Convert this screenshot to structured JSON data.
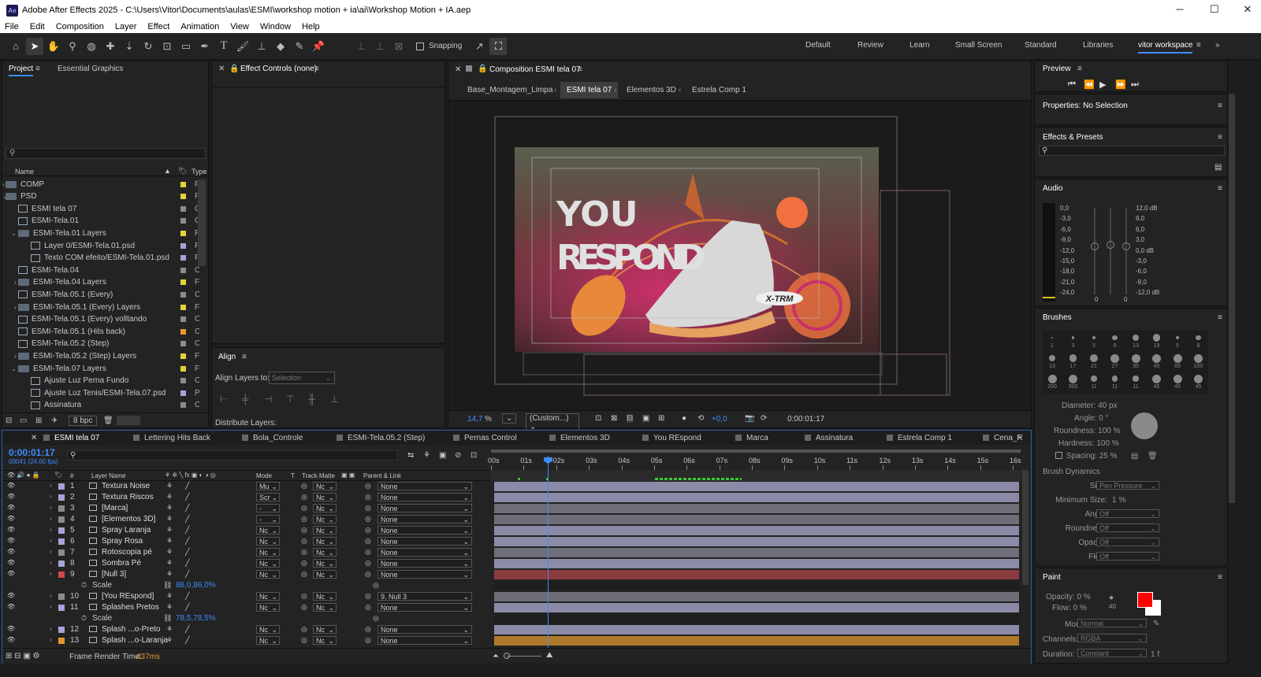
{
  "titlebar": {
    "app_icon": "Ae",
    "title": "Adobe After Effects 2025 - C:\\Users\\Vitor\\Documents\\aulas\\ESMI\\workshop motion + ia\\ai\\Workshop Motion + IA.aep"
  },
  "menu": [
    "File",
    "Edit",
    "Composition",
    "Layer",
    "Effect",
    "Animation",
    "View",
    "Window",
    "Help"
  ],
  "toolbar": {
    "snapping": "Snapping"
  },
  "workspaces": [
    "Default",
    "Review",
    "Learn",
    "Small Screen",
    "Standard",
    "Libraries",
    "vitor workspace"
  ],
  "project": {
    "tab_project": "Project",
    "tab_essential": "Essential Graphics",
    "col_name": "Name",
    "col_type": "Type",
    "items": [
      {
        "name": "COMP",
        "type": "Fo",
        "color": "#e3d23c",
        "indent": 0,
        "kind": "folder",
        "twirl": "right"
      },
      {
        "name": "PSD",
        "type": "Fo",
        "color": "#e3d23c",
        "indent": 0,
        "kind": "folder",
        "twirl": "down"
      },
      {
        "name": "ESMI tela 07",
        "type": "C",
        "color": "#8c8c8c",
        "indent": 1,
        "kind": "comp",
        "twirl": ""
      },
      {
        "name": "ESMI-Tela.01",
        "type": "C",
        "color": "#8c8c8c",
        "indent": 1,
        "kind": "comp",
        "twirl": ""
      },
      {
        "name": "ESMI-Tela.01 Layers",
        "type": "Fo",
        "color": "#e3d23c",
        "indent": 1,
        "kind": "folder",
        "twirl": "down"
      },
      {
        "name": "Layer 0/ESMI-Tela.01.psd",
        "type": "Pl",
        "color": "#a4a4d8",
        "indent": 2,
        "kind": "comp",
        "twirl": ""
      },
      {
        "name": "Texto COM efeito/ESMI-Tela.01.psd",
        "type": "Pl",
        "color": "#a4a4d8",
        "indent": 2,
        "kind": "comp",
        "twirl": ""
      },
      {
        "name": "ESMI-Tela.04",
        "type": "C",
        "color": "#8c8c8c",
        "indent": 1,
        "kind": "comp",
        "twirl": ""
      },
      {
        "name": "ESMI-Tela.04 Layers",
        "type": "Fo",
        "color": "#e3d23c",
        "indent": 1,
        "kind": "folder",
        "twirl": "right"
      },
      {
        "name": "ESMI-Tela.05.1 (Every)",
        "type": "C",
        "color": "#8c8c8c",
        "indent": 1,
        "kind": "comp",
        "twirl": ""
      },
      {
        "name": "ESMI-Tela.05.1 (Every) Layers",
        "type": "Fo",
        "color": "#e3d23c",
        "indent": 1,
        "kind": "folder",
        "twirl": "right"
      },
      {
        "name": "ESMI-Tela.05.1 (Every) volltando",
        "type": "C",
        "color": "#8c8c8c",
        "indent": 1,
        "kind": "comp",
        "twirl": ""
      },
      {
        "name": "ESMI-Tela.05.1 (Hits back)",
        "type": "C",
        "color": "#e39a2c",
        "indent": 1,
        "kind": "comp",
        "twirl": ""
      },
      {
        "name": "ESMI-Tela.05.2 (Step)",
        "type": "C",
        "color": "#8c8c8c",
        "indent": 1,
        "kind": "comp",
        "twirl": ""
      },
      {
        "name": "ESMI-Tela.05.2 (Step) Layers",
        "type": "Fo",
        "color": "#e3d23c",
        "indent": 1,
        "kind": "folder",
        "twirl": "right"
      },
      {
        "name": "ESMI-Tela.07 Layers",
        "type": "Fo",
        "color": "#e3d23c",
        "indent": 1,
        "kind": "folder",
        "twirl": "down"
      },
      {
        "name": "Ajuste Luz Perna Fundo",
        "type": "C",
        "color": "#8c8c8c",
        "indent": 2,
        "kind": "comp",
        "twirl": ""
      },
      {
        "name": "Ajuste Luz Tenis/ESMI-Tela.07.psd",
        "type": "Pl",
        "color": "#a4a4d8",
        "indent": 2,
        "kind": "comp",
        "twirl": ""
      },
      {
        "name": "Assinatura",
        "type": "C",
        "color": "#8c8c8c",
        "indent": 2,
        "kind": "comp",
        "twirl": ""
      }
    ],
    "bpc": "8 bpc"
  },
  "effect_controls": {
    "title": "Effect Controls (none)"
  },
  "align": {
    "title": "Align",
    "align_to_label": "Align Layers to:",
    "align_to_value": "Selection",
    "distribute": "Distribute Layers:"
  },
  "composition": {
    "title": "Composition ESMI tela 07",
    "breadcrumbs": [
      "Base_Montagem_Limpa",
      "ESMI tela 07",
      "Elementos 3D",
      "Estrela Comp 1"
    ],
    "artwork_text": "YOU RESPOND",
    "brand": "X-TRM",
    "zoom": "14,7",
    "zoom_unit": "%",
    "resolution": "(Custom...)",
    "exposure": "+0,0",
    "timecode": "0:00:01:17"
  },
  "right": {
    "preview": "Preview",
    "properties": "Properties: No Selection",
    "effects_presets": "Effects & Presets",
    "audio": "Audio",
    "audio_left": [
      "0,0",
      "-3,0",
      "-6,0",
      "-9,0",
      "-12,0",
      "-15,0",
      "-18,0",
      "-21,0",
      "-24,0"
    ],
    "audio_right": [
      "12,0 dB",
      "9,0",
      "6,0",
      "3,0",
      "0,0 dB",
      "-3,0",
      "-6,0",
      "-9,0",
      "-12,0 dB"
    ],
    "audio_zero_left": "0",
    "audio_zero_right": "0",
    "brushes": "Brushes",
    "brush_sizes": [
      "1",
      "3",
      "5",
      "9",
      "13",
      "19",
      "5",
      "9",
      "13",
      "17",
      "21",
      "27",
      "35",
      "45",
      "65",
      "100",
      "200",
      "300",
      "11",
      "11",
      "11",
      "45",
      "45",
      "45"
    ],
    "diameter": "Diameter: 40 px",
    "angle": "Angle: 0 °",
    "roundness": "Roundness: 100 %",
    "hardness": "Hardness: 100 %",
    "spacing": "Spacing: 25 %",
    "brush_dynamics": "Brush Dynamics",
    "dyn": [
      {
        "label": "Size:",
        "value": "Pen Pressure"
      },
      {
        "label": "Minimum Size:",
        "value": "1 %"
      },
      {
        "label": "Angle:",
        "value": "Off"
      },
      {
        "label": "Roundness:",
        "value": "Off"
      },
      {
        "label": "Opacity:",
        "value": "Off"
      },
      {
        "label": "Flow:",
        "value": "Off"
      }
    ],
    "paint": "Paint",
    "opacity": "Opacity: 0 %",
    "flow": "Flow: 0 %",
    "paint_num": "40",
    "mode_label": "Mode:",
    "mode_value": "Normal",
    "channels_label": "Channels:",
    "channels_value": "RGBA",
    "duration_label": "Duration:",
    "duration_value": "Constant",
    "duration_suffix": "1 f",
    "fg_color": "#ff0000",
    "bg_color": "#ffffff"
  },
  "timeline": {
    "tabs": [
      "ESMI tela 07",
      "Lettering Hits Back",
      "Bola_Controle",
      "ESMI-Tela.05.2 (Step)",
      "Pernas Control",
      "Elementos 3D",
      "You REspond",
      "Marca",
      "Assinatura",
      "Estrela Comp 1",
      "Cena_R"
    ],
    "timecode": "0:00:01:17",
    "timecode_sub": "00041 (24.00 fps)",
    "col_layer": "Layer Name",
    "col_mode": "Mode",
    "col_t": "T",
    "col_matte": "Track Matte",
    "col_parent": "Parent & Link",
    "ruler": [
      "00s",
      "01s",
      "02s",
      "03s",
      "04s",
      "05s",
      "06s",
      "07s",
      "08s",
      "09s",
      "10s",
      "11s",
      "12s",
      "13s",
      "14s",
      "15s",
      "16s"
    ],
    "layers": [
      {
        "num": "1",
        "name": "Textura Noise",
        "mode": "Mu",
        "matte": "Nc",
        "parent": "None",
        "color": "#a4a4d8",
        "bar": "#8b8ba8",
        "kind": "layer"
      },
      {
        "num": "2",
        "name": "Textura Riscos",
        "mode": "Scr",
        "matte": "Nc",
        "parent": "None",
        "color": "#a4a4d8",
        "bar": "#8b8ba8",
        "kind": "layer"
      },
      {
        "num": "3",
        "name": "[Marca]",
        "mode": "-",
        "matte": "Nc",
        "parent": "None",
        "color": "#8c8c8c",
        "bar": "#6e6e78",
        "kind": "layer"
      },
      {
        "num": "4",
        "name": "[Elementos 3D]",
        "mode": "-",
        "matte": "Nc",
        "parent": "None",
        "color": "#8c8c8c",
        "bar": "#6e6e78",
        "kind": "layer"
      },
      {
        "num": "5",
        "name": "Spray Laranja",
        "mode": "Nc",
        "matte": "Nc",
        "parent": "None",
        "color": "#a4a4d8",
        "bar": "#8b8ba8",
        "kind": "layer"
      },
      {
        "num": "6",
        "name": "Spray Rosa",
        "mode": "Nc",
        "matte": "Nc",
        "parent": "None",
        "color": "#a4a4d8",
        "bar": "#8b8ba8",
        "kind": "layer"
      },
      {
        "num": "7",
        "name": "Rotoscopia pé",
        "mode": "Nc",
        "matte": "Nc",
        "parent": "None",
        "color": "#8c8c8c",
        "bar": "#6e6e78",
        "kind": "layer"
      },
      {
        "num": "8",
        "name": "Sombra Pé",
        "mode": "Nc",
        "matte": "Nc",
        "parent": "None",
        "color": "#a4a4d8",
        "bar": "#8b8ba8",
        "kind": "layer"
      },
      {
        "num": "9",
        "name": "[Null 3]",
        "mode": "Nc",
        "matte": "Nc",
        "parent": "None",
        "color": "#d04848",
        "bar": "#8a3b3e",
        "kind": "layer"
      },
      {
        "num": "",
        "name": "Scale",
        "mode": "",
        "matte": "",
        "parent": "86,0,86,0%",
        "color": "",
        "bar": "",
        "kind": "prop"
      },
      {
        "num": "10",
        "name": "[You REspond]",
        "mode": "Nc",
        "matte": "Nc",
        "parent": "9. Null 3",
        "color": "#8c8c8c",
        "bar": "#6e6e78",
        "kind": "layer"
      },
      {
        "num": "11",
        "name": "Splashes Pretos",
        "mode": "Nc",
        "matte": "Nc",
        "parent": "None",
        "color": "#a4a4d8",
        "bar": "#8b8ba8",
        "kind": "layer"
      },
      {
        "num": "",
        "name": "Scale",
        "mode": "",
        "matte": "",
        "parent": "78,5,78,5%",
        "color": "",
        "bar": "",
        "kind": "prop"
      },
      {
        "num": "12",
        "name": "Splash ...o-Preto",
        "mode": "Nc",
        "matte": "Nc",
        "parent": "None",
        "color": "#a4a4d8",
        "bar": "#8b8ba8",
        "kind": "layer"
      },
      {
        "num": "13",
        "name": "Splash ...o-Laranja",
        "mode": "Nc",
        "matte": "Nc",
        "parent": "None",
        "color": "#e3962c",
        "bar": "#b07a2a",
        "kind": "layer"
      }
    ],
    "frame_render": "Frame Render Time:",
    "frame_render_value": "437ms"
  }
}
